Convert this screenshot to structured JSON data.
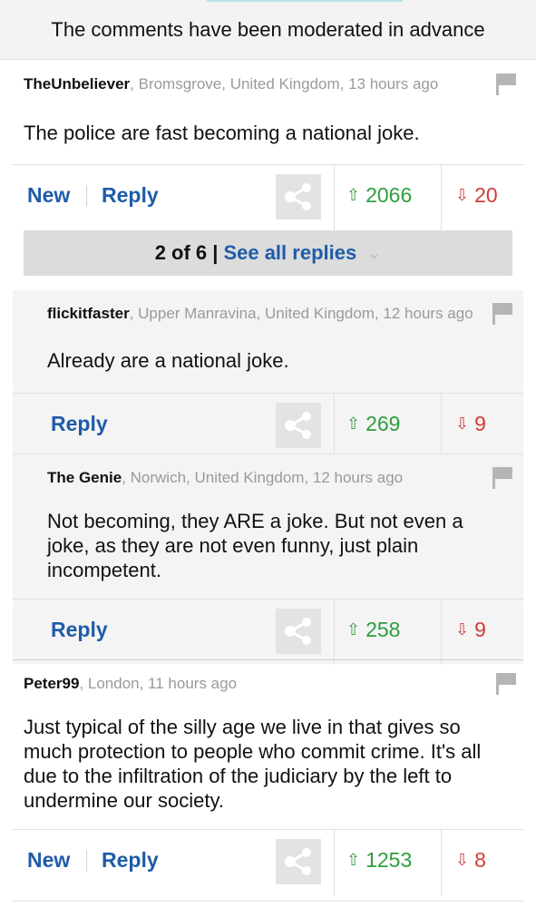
{
  "notice": "The comments have been moderated in advance",
  "comments": [
    {
      "author": "TheUnbeliever",
      "location_time": ", Bromsgrove, United Kingdom, 13 hours ago",
      "body": "The police are fast becoming a national joke.",
      "new_label": "New",
      "reply_label": "Reply",
      "upvotes": "2066",
      "downvotes": "20"
    },
    {
      "author": "Peter99",
      "location_time": ", London, 11 hours ago",
      "body": "Just typical of the silly age we live in that gives so much protection to people who commit  crime. It's all due to the infiltration of the judiciary by the left to undermine our society.",
      "new_label": "New",
      "reply_label": "Reply",
      "upvotes": "1253",
      "downvotes": "8"
    }
  ],
  "replies_bar": {
    "count": "2 of 6 |",
    "link": "See all replies"
  },
  "replies": [
    {
      "author": "flickitfaster",
      "location_time": ", Upper Manravina, United Kingdom, 12 hours ago",
      "body": "Already are a national joke.",
      "reply_label": "Reply",
      "upvotes": "269",
      "downvotes": "9"
    },
    {
      "author": "The Genie",
      "location_time": ", Norwich, United Kingdom, 12 hours ago",
      "body": "Not becoming, they ARE a joke. But not even a joke, as they are not even funny, just plain incompetent.",
      "reply_label": "Reply",
      "upvotes": "258",
      "downvotes": "9"
    }
  ],
  "colors": {
    "link_blue": "#1f5ca8",
    "upvote_green": "#2f9e3e",
    "downvote_red": "#d13b3b"
  },
  "icons": [
    "flag-icon",
    "share-icon",
    "upvote-arrow-icon",
    "downvote-arrow-icon",
    "chevron-down-icon"
  ]
}
